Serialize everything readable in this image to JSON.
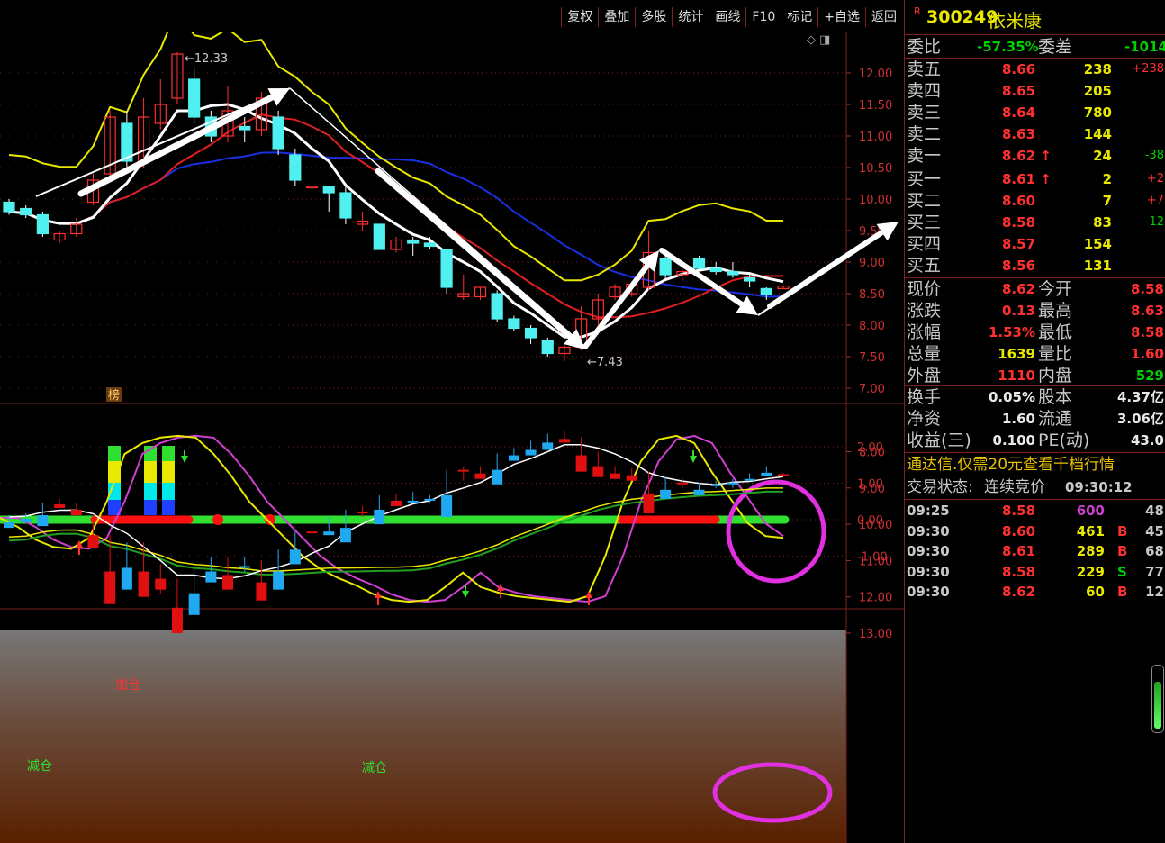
{
  "toolbar": {
    "buttons": [
      "复权",
      "叠加",
      "多股",
      "统计",
      "画线",
      "F10",
      "标记",
      "+自选",
      "返回"
    ]
  },
  "chart_data": {
    "type": "candlestick",
    "price_axis": {
      "ticks": [
        "12.00",
        "11.50",
        "11.00",
        "10.50",
        "10.00",
        "9.50",
        "9.00",
        "8.50",
        "8.00",
        "7.50",
        "7.00"
      ]
    },
    "indicator_axis": {
      "ticks": [
        "2.00",
        "1.00",
        "0.00",
        "-1.00"
      ]
    },
    "lower_axis": {
      "ticks": [
        "13.00",
        "12.00",
        "11.00",
        "10.00",
        "9.00",
        "8.00"
      ]
    },
    "high_marker": "12.33",
    "low_marker": "7.43",
    "badge": "榜",
    "lower_labels": {
      "add": "加仓",
      "reduce1": "减仓",
      "reduce2": "减仓"
    },
    "candles": [
      {
        "o": 9.95,
        "c": 9.8,
        "h": 10.0,
        "l": 9.75
      },
      {
        "o": 9.85,
        "c": 9.75,
        "h": 9.9,
        "l": 9.7
      },
      {
        "o": 9.75,
        "c": 9.45,
        "h": 9.8,
        "l": 9.4
      },
      {
        "o": 9.35,
        "c": 9.45,
        "h": 9.5,
        "l": 9.3
      },
      {
        "o": 9.45,
        "c": 9.6,
        "h": 9.7,
        "l": 9.4
      },
      {
        "o": 9.95,
        "c": 10.3,
        "h": 10.4,
        "l": 9.9
      },
      {
        "o": 10.4,
        "c": 11.3,
        "h": 11.4,
        "l": 10.3
      },
      {
        "o": 11.2,
        "c": 10.6,
        "h": 11.4,
        "l": 10.5
      },
      {
        "o": 10.6,
        "c": 11.3,
        "h": 11.6,
        "l": 10.5
      },
      {
        "o": 11.2,
        "c": 11.5,
        "h": 11.9,
        "l": 11.1
      },
      {
        "o": 11.6,
        "c": 12.3,
        "h": 12.33,
        "l": 11.5
      },
      {
        "o": 11.9,
        "c": 11.3,
        "h": 12.1,
        "l": 11.2
      },
      {
        "o": 11.3,
        "c": 11.0,
        "h": 11.4,
        "l": 10.9
      },
      {
        "o": 11.0,
        "c": 11.4,
        "h": 11.8,
        "l": 10.9
      },
      {
        "o": 11.15,
        "c": 11.1,
        "h": 11.3,
        "l": 10.9
      },
      {
        "o": 11.1,
        "c": 11.6,
        "h": 11.7,
        "l": 11.0
      },
      {
        "o": 11.3,
        "c": 10.8,
        "h": 11.4,
        "l": 10.7
      },
      {
        "o": 10.7,
        "c": 10.3,
        "h": 10.8,
        "l": 10.2
      },
      {
        "o": 10.2,
        "c": 10.2,
        "h": 10.3,
        "l": 10.1
      },
      {
        "o": 10.2,
        "c": 10.1,
        "h": 10.2,
        "l": 9.8
      },
      {
        "o": 10.1,
        "c": 9.7,
        "h": 10.2,
        "l": 9.6
      },
      {
        "o": 9.6,
        "c": 9.65,
        "h": 9.8,
        "l": 9.5
      },
      {
        "o": 9.6,
        "c": 9.2,
        "h": 9.6,
        "l": 9.2
      },
      {
        "o": 9.2,
        "c": 9.35,
        "h": 9.4,
        "l": 9.15
      },
      {
        "o": 9.35,
        "c": 9.3,
        "h": 9.4,
        "l": 9.1
      },
      {
        "o": 9.3,
        "c": 9.25,
        "h": 9.4,
        "l": 9.2
      },
      {
        "o": 9.2,
        "c": 8.6,
        "h": 9.2,
        "l": 8.5
      },
      {
        "o": 8.45,
        "c": 8.5,
        "h": 8.8,
        "l": 8.4
      },
      {
        "o": 8.45,
        "c": 8.6,
        "h": 8.6,
        "l": 8.4
      },
      {
        "o": 8.5,
        "c": 8.1,
        "h": 8.55,
        "l": 8.05
      },
      {
        "o": 8.1,
        "c": 7.95,
        "h": 8.15,
        "l": 7.9
      },
      {
        "o": 7.95,
        "c": 7.8,
        "h": 8.0,
        "l": 7.7
      },
      {
        "o": 7.75,
        "c": 7.55,
        "h": 7.8,
        "l": 7.5
      },
      {
        "o": 7.55,
        "c": 7.65,
        "h": 7.7,
        "l": 7.43
      },
      {
        "o": 7.65,
        "c": 8.1,
        "h": 8.3,
        "l": 7.6
      },
      {
        "o": 8.1,
        "c": 8.4,
        "h": 8.5,
        "l": 8.0
      },
      {
        "o": 8.45,
        "c": 8.6,
        "h": 8.65,
        "l": 8.4
      },
      {
        "o": 8.5,
        "c": 8.65,
        "h": 8.7,
        "l": 8.45
      },
      {
        "o": 8.6,
        "c": 9.15,
        "h": 9.5,
        "l": 8.55
      },
      {
        "o": 9.05,
        "c": 8.8,
        "h": 9.15,
        "l": 8.7
      },
      {
        "o": 8.8,
        "c": 8.85,
        "h": 9.0,
        "l": 8.7
      },
      {
        "o": 9.05,
        "c": 8.9,
        "h": 9.1,
        "l": 8.85
      },
      {
        "o": 8.9,
        "c": 8.85,
        "h": 9.0,
        "l": 8.8
      },
      {
        "o": 8.85,
        "c": 8.8,
        "h": 9.0,
        "l": 8.75
      },
      {
        "o": 8.75,
        "c": 8.7,
        "h": 8.8,
        "l": 8.6
      },
      {
        "o": 8.58,
        "c": 8.48,
        "h": 8.6,
        "l": 8.4
      },
      {
        "o": 8.58,
        "c": 8.62,
        "h": 8.63,
        "l": 8.58
      }
    ]
  },
  "quote": {
    "code": "300249",
    "name": "依米康",
    "weibi_label": "委比",
    "weibi": "-57.35%",
    "weicha_label": "委差",
    "weicha": "-1014",
    "asks": [
      {
        "label": "卖五",
        "price": "8.66",
        "vol": "238",
        "chg": "+238"
      },
      {
        "label": "卖四",
        "price": "8.65",
        "vol": "205",
        "chg": ""
      },
      {
        "label": "卖三",
        "price": "8.64",
        "vol": "780",
        "chg": ""
      },
      {
        "label": "卖二",
        "price": "8.63",
        "vol": "144",
        "chg": ""
      },
      {
        "label": "卖一",
        "price": "8.62",
        "vol": "24",
        "chg": "-38"
      }
    ],
    "bids": [
      {
        "label": "买一",
        "price": "8.61",
        "vol": "2",
        "chg": "+2"
      },
      {
        "label": "买二",
        "price": "8.60",
        "vol": "7",
        "chg": "+7"
      },
      {
        "label": "买三",
        "price": "8.58",
        "vol": "83",
        "chg": "-12"
      },
      {
        "label": "买四",
        "price": "8.57",
        "vol": "154",
        "chg": ""
      },
      {
        "label": "买五",
        "price": "8.56",
        "vol": "131",
        "chg": ""
      }
    ],
    "stats": [
      {
        "l1": "现价",
        "v1": "8.62",
        "l2": "今开",
        "v2": "8.58"
      },
      {
        "l1": "涨跌",
        "v1": "0.13",
        "l2": "最高",
        "v2": "8.63"
      },
      {
        "l1": "涨幅",
        "v1": "1.53%",
        "l2": "最低",
        "v2": "8.58"
      },
      {
        "l1": "总量",
        "v1": "1639",
        "l2": "量比",
        "v2": "1.60"
      },
      {
        "l1": "外盘",
        "v1": "1110",
        "l2": "内盘",
        "v2": "529"
      }
    ],
    "stats2": [
      {
        "l1": "换手",
        "v1": "0.05%",
        "l2": "股本",
        "v2": "4.37亿"
      },
      {
        "l1": "净资",
        "v1": "1.60",
        "l2": "流通",
        "v2": "3.06亿"
      },
      {
        "l1": "收益(三)",
        "v1": "0.100",
        "l2": "PE(动)",
        "v2": "43.0"
      }
    ],
    "promo": "通达信.仅需20元查看千档行情",
    "status_label": "交易状态:",
    "status": "连续竞价",
    "status_time": "09:30:12",
    "ticks": [
      {
        "t": "09:25",
        "p": "8.58",
        "v": "600",
        "bs": "",
        "n": "48"
      },
      {
        "t": "09:30",
        "p": "8.60",
        "v": "461",
        "bs": "B",
        "n": "45"
      },
      {
        "t": "09:30",
        "p": "8.61",
        "v": "289",
        "bs": "B",
        "n": "68"
      },
      {
        "t": "09:30",
        "p": "8.58",
        "v": "229",
        "bs": "S",
        "n": "77"
      },
      {
        "t": "09:30",
        "p": "8.62",
        "v": "60",
        "bs": "B",
        "n": "12"
      }
    ],
    "colors": {
      "up": "#ff3030",
      "down": "#00d000",
      "neutral": "#e8e8e8"
    }
  }
}
